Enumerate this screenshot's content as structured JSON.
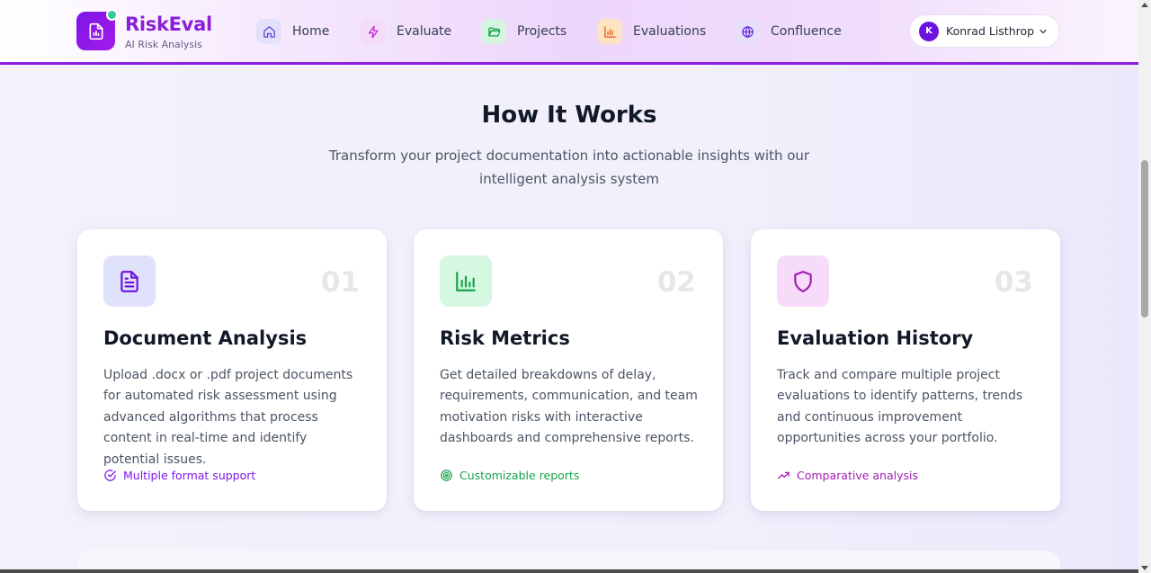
{
  "brand": {
    "name": "RiskEval",
    "tagline": "AI Risk Analysis",
    "logo_icon": "document-chart-icon"
  },
  "nav": [
    {
      "label": "Home",
      "icon": "home-icon"
    },
    {
      "label": "Evaluate",
      "icon": "lightning-icon"
    },
    {
      "label": "Projects",
      "icon": "folder-open-icon"
    },
    {
      "label": "Evaluations",
      "icon": "bar-chart-icon"
    },
    {
      "label": "Confluence",
      "icon": "globe-icon"
    }
  ],
  "user": {
    "initial": "K",
    "name": "Konrad Listhrop"
  },
  "section": {
    "title": "How It Works",
    "subtitle": "Transform your project documentation into actionable insights with our intelligent analysis system"
  },
  "cards": [
    {
      "number": "01",
      "title": "Document Analysis",
      "description": "Upload .docx or .pdf project documents for automated risk assessment using advanced algorithms that process content in real-time and identify potential issues.",
      "feature": "Multiple format support",
      "icon": "document-icon",
      "feature_icon": "check-circle-icon",
      "accent": "#7c16e8",
      "icon_bg": "#e0e2fb"
    },
    {
      "number": "02",
      "title": "Risk Metrics",
      "description": "Get detailed breakdowns of delay, requirements, communication, and team motivation risks with interactive dashboards and comprehensive reports.",
      "feature": "Customizable reports",
      "icon": "bar-chart-icon",
      "feature_icon": "target-icon",
      "accent": "#16a34a",
      "icon_bg": "#d6f7e2"
    },
    {
      "number": "03",
      "title": "Evaluation History",
      "description": "Track and compare multiple project evaluations to identify patterns, trends and continuous improvement opportunities across your portfolio.",
      "feature": "Comparative analysis",
      "icon": "shield-icon",
      "feature_icon": "trending-up-icon",
      "accent": "#a21caf",
      "icon_bg": "#f7dcfa"
    }
  ]
}
